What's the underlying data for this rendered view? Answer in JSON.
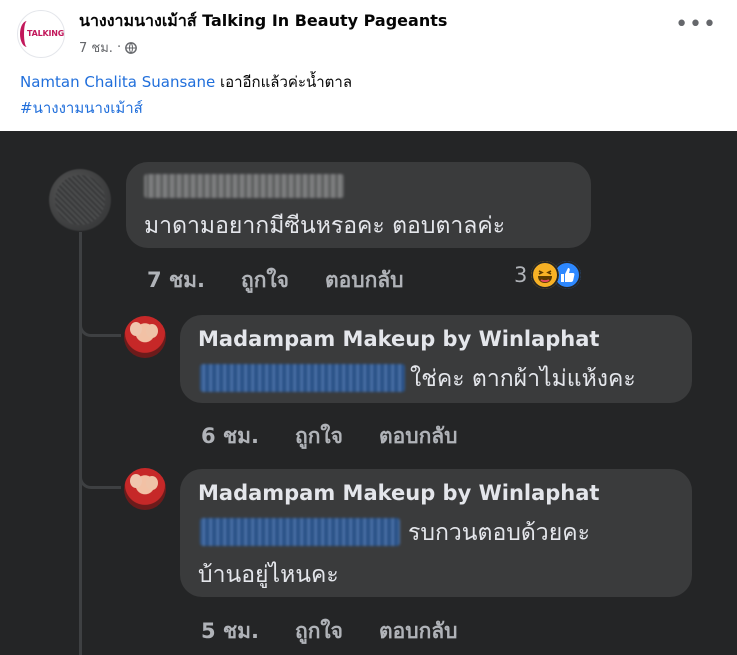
{
  "post": {
    "page_name": "นางงามนางเม้าส์ Talking In Beauty Pageants",
    "time": "7 ชม.",
    "separator": "·",
    "logo_text": "TALKING",
    "mention": "Namtan Chalita Suansane",
    "text": "เอาอีกแล้วค่ะน้ำตาล",
    "hashtag": "#นางงามนางเม้าส์",
    "more_label": "•••"
  },
  "comments": [
    {
      "body": "มาดามอยากมีซีนหรอคะ ตอบตาลค่ะ",
      "time": "7 ชม.",
      "like": "ถูกใจ",
      "reply": "ตอบกลับ",
      "reaction_count": "3",
      "reactions": [
        "haha-icon",
        "like-icon"
      ]
    },
    {
      "author": "Madampam Makeup by Winlaphat",
      "body_line1": "ใช่คะ ตากผ้าไม่แห้งคะ",
      "time": "6 ชม.",
      "like": "ถูกใจ",
      "reply": "ตอบกลับ"
    },
    {
      "author": "Madampam Makeup by Winlaphat",
      "body_line1": "รบกวนตอบด้วยคะ",
      "body_line2": "บ้านอยู่ไหนคะ",
      "time": "5 ชม.",
      "like": "ถูกใจ",
      "reply": "ตอบกลับ"
    }
  ],
  "colors": {
    "dark_bg": "#242526",
    "bubble": "#3a3b3c",
    "link": "#216fdb"
  }
}
